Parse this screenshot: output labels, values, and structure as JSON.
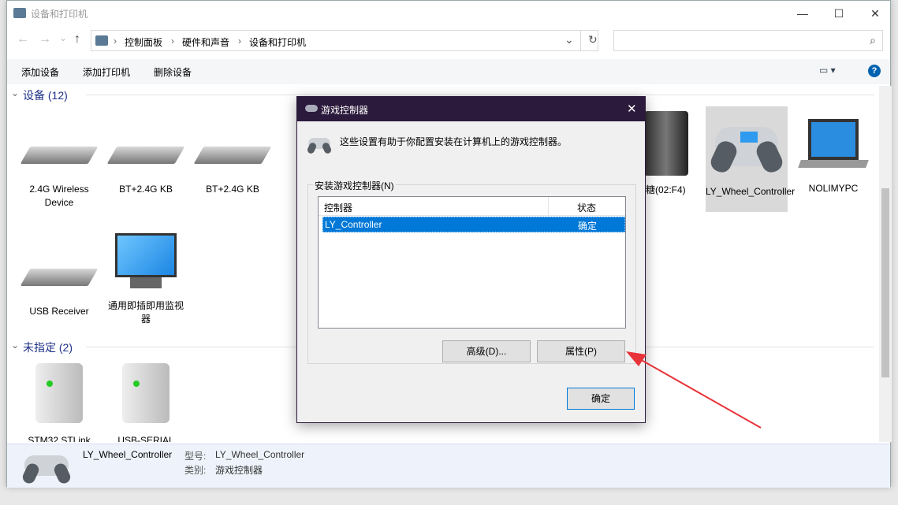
{
  "window": {
    "title": "设备和打印机",
    "minimize": "—",
    "maximize": "☐",
    "close": "✕"
  },
  "nav": {
    "back": "←",
    "forward": "→",
    "recent": "⌄",
    "up": "↑",
    "refresh": "↻",
    "dropdown": "⌄",
    "search_placeholder": "",
    "search_icon": "⌕"
  },
  "breadcrumb": [
    "控制面板",
    "硬件和声音",
    "设备和打印机"
  ],
  "sep": "›",
  "commands": [
    "添加设备",
    "添加打印机",
    "删除设备"
  ],
  "view_icon": "▭ ▾",
  "help": "?",
  "sections": [
    {
      "label": "设备 (12)",
      "devices": [
        {
          "name": "2.4G Wireless Device",
          "icon": "keyboard"
        },
        {
          "name": "BT+2.4G KB",
          "icon": "keyboard"
        },
        {
          "name": "BT+2.4G KB",
          "icon": "keyboard"
        },
        {
          "name": "糖(02:F4)",
          "icon": "speaker"
        },
        {
          "name": "LY_Wheel_Controller",
          "icon": "gamepad",
          "selected": true
        },
        {
          "name": "NOLIMYPC",
          "icon": "laptop"
        },
        {
          "name": "USB Receiver",
          "icon": "keyboard"
        },
        {
          "name": "通用即插即用监视器",
          "icon": "monitor"
        }
      ]
    },
    {
      "label": "未指定 (2)",
      "devices": [
        {
          "name": "STM32 STLink",
          "icon": "server"
        },
        {
          "name": "USB-SERIAL",
          "icon": "server"
        }
      ]
    }
  ],
  "details": {
    "name": "LY_Wheel_Controller",
    "model_label": "型号:",
    "model": "LY_Wheel_Controller",
    "category_label": "类别:",
    "category": "游戏控制器"
  },
  "dialog": {
    "title": "游戏控制器",
    "close": "✕",
    "description": "这些设置有助于你配置安装在计算机上的游戏控制器。",
    "group": "安装游戏控制器(N)",
    "columns": [
      "控制器",
      "状态"
    ],
    "rows": [
      {
        "name": "LY_Controller",
        "status": "确定"
      }
    ],
    "advanced": "高级(D)...",
    "properties": "属性(P)",
    "ok": "确定"
  },
  "colors": {
    "accent": "#0078d7",
    "dialog_title": "#2b1a3c",
    "arrow": "#e8333a"
  }
}
